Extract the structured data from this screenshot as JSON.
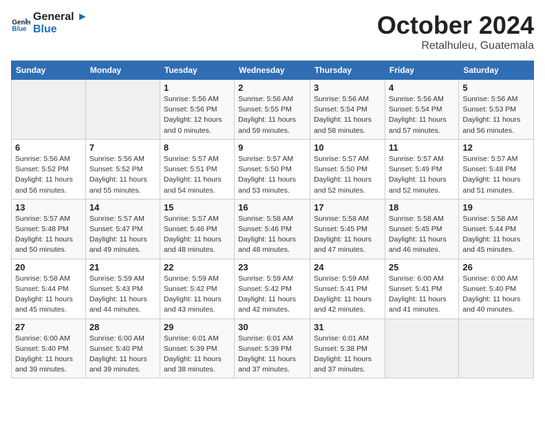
{
  "header": {
    "logo_line1": "General",
    "logo_line2": "Blue",
    "month": "October 2024",
    "location": "Retalhuleu, Guatemala"
  },
  "weekdays": [
    "Sunday",
    "Monday",
    "Tuesday",
    "Wednesday",
    "Thursday",
    "Friday",
    "Saturday"
  ],
  "weeks": [
    [
      {
        "day": "",
        "info": ""
      },
      {
        "day": "",
        "info": ""
      },
      {
        "day": "1",
        "info": "Sunrise: 5:56 AM\nSunset: 5:56 PM\nDaylight: 12 hours\nand 0 minutes."
      },
      {
        "day": "2",
        "info": "Sunrise: 5:56 AM\nSunset: 5:55 PM\nDaylight: 11 hours\nand 59 minutes."
      },
      {
        "day": "3",
        "info": "Sunrise: 5:56 AM\nSunset: 5:54 PM\nDaylight: 11 hours\nand 58 minutes."
      },
      {
        "day": "4",
        "info": "Sunrise: 5:56 AM\nSunset: 5:54 PM\nDaylight: 11 hours\nand 57 minutes."
      },
      {
        "day": "5",
        "info": "Sunrise: 5:56 AM\nSunset: 5:53 PM\nDaylight: 11 hours\nand 56 minutes."
      }
    ],
    [
      {
        "day": "6",
        "info": "Sunrise: 5:56 AM\nSunset: 5:52 PM\nDaylight: 11 hours\nand 56 minutes."
      },
      {
        "day": "7",
        "info": "Sunrise: 5:56 AM\nSunset: 5:52 PM\nDaylight: 11 hours\nand 55 minutes."
      },
      {
        "day": "8",
        "info": "Sunrise: 5:57 AM\nSunset: 5:51 PM\nDaylight: 11 hours\nand 54 minutes."
      },
      {
        "day": "9",
        "info": "Sunrise: 5:57 AM\nSunset: 5:50 PM\nDaylight: 11 hours\nand 53 minutes."
      },
      {
        "day": "10",
        "info": "Sunrise: 5:57 AM\nSunset: 5:50 PM\nDaylight: 11 hours\nand 52 minutes."
      },
      {
        "day": "11",
        "info": "Sunrise: 5:57 AM\nSunset: 5:49 PM\nDaylight: 11 hours\nand 52 minutes."
      },
      {
        "day": "12",
        "info": "Sunrise: 5:57 AM\nSunset: 5:48 PM\nDaylight: 11 hours\nand 51 minutes."
      }
    ],
    [
      {
        "day": "13",
        "info": "Sunrise: 5:57 AM\nSunset: 5:48 PM\nDaylight: 11 hours\nand 50 minutes."
      },
      {
        "day": "14",
        "info": "Sunrise: 5:57 AM\nSunset: 5:47 PM\nDaylight: 11 hours\nand 49 minutes."
      },
      {
        "day": "15",
        "info": "Sunrise: 5:57 AM\nSunset: 5:46 PM\nDaylight: 11 hours\nand 48 minutes."
      },
      {
        "day": "16",
        "info": "Sunrise: 5:58 AM\nSunset: 5:46 PM\nDaylight: 11 hours\nand 48 minutes."
      },
      {
        "day": "17",
        "info": "Sunrise: 5:58 AM\nSunset: 5:45 PM\nDaylight: 11 hours\nand 47 minutes."
      },
      {
        "day": "18",
        "info": "Sunrise: 5:58 AM\nSunset: 5:45 PM\nDaylight: 11 hours\nand 46 minutes."
      },
      {
        "day": "19",
        "info": "Sunrise: 5:58 AM\nSunset: 5:44 PM\nDaylight: 11 hours\nand 45 minutes."
      }
    ],
    [
      {
        "day": "20",
        "info": "Sunrise: 5:58 AM\nSunset: 5:44 PM\nDaylight: 11 hours\nand 45 minutes."
      },
      {
        "day": "21",
        "info": "Sunrise: 5:59 AM\nSunset: 5:43 PM\nDaylight: 11 hours\nand 44 minutes."
      },
      {
        "day": "22",
        "info": "Sunrise: 5:59 AM\nSunset: 5:42 PM\nDaylight: 11 hours\nand 43 minutes."
      },
      {
        "day": "23",
        "info": "Sunrise: 5:59 AM\nSunset: 5:42 PM\nDaylight: 11 hours\nand 42 minutes."
      },
      {
        "day": "24",
        "info": "Sunrise: 5:59 AM\nSunset: 5:41 PM\nDaylight: 11 hours\nand 42 minutes."
      },
      {
        "day": "25",
        "info": "Sunrise: 6:00 AM\nSunset: 5:41 PM\nDaylight: 11 hours\nand 41 minutes."
      },
      {
        "day": "26",
        "info": "Sunrise: 6:00 AM\nSunset: 5:40 PM\nDaylight: 11 hours\nand 40 minutes."
      }
    ],
    [
      {
        "day": "27",
        "info": "Sunrise: 6:00 AM\nSunset: 5:40 PM\nDaylight: 11 hours\nand 39 minutes."
      },
      {
        "day": "28",
        "info": "Sunrise: 6:00 AM\nSunset: 5:40 PM\nDaylight: 11 hours\nand 39 minutes."
      },
      {
        "day": "29",
        "info": "Sunrise: 6:01 AM\nSunset: 5:39 PM\nDaylight: 11 hours\nand 38 minutes."
      },
      {
        "day": "30",
        "info": "Sunrise: 6:01 AM\nSunset: 5:39 PM\nDaylight: 11 hours\nand 37 minutes."
      },
      {
        "day": "31",
        "info": "Sunrise: 6:01 AM\nSunset: 5:38 PM\nDaylight: 11 hours\nand 37 minutes."
      },
      {
        "day": "",
        "info": ""
      },
      {
        "day": "",
        "info": ""
      }
    ]
  ]
}
